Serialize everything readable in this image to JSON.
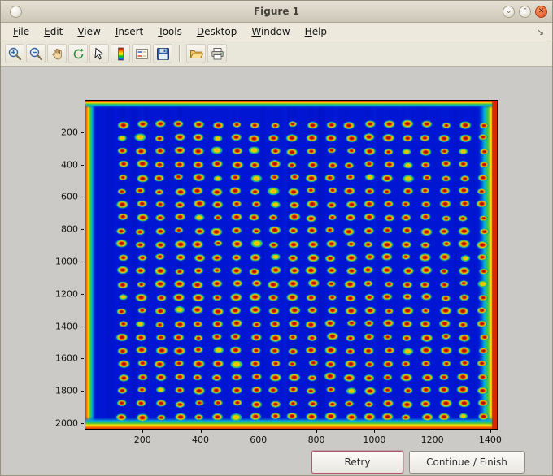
{
  "window": {
    "title": "Figure 1",
    "controls": {
      "shade": "⌄",
      "maximize": "⌃",
      "close": "✕"
    }
  },
  "menu": {
    "items": [
      {
        "label": "File"
      },
      {
        "label": "Edit"
      },
      {
        "label": "View"
      },
      {
        "label": "Insert"
      },
      {
        "label": "Tools"
      },
      {
        "label": "Desktop"
      },
      {
        "label": "Window"
      },
      {
        "label": "Help"
      }
    ],
    "dock_arrow": "↘"
  },
  "toolbar": {
    "tools": [
      "zoom-in",
      "zoom-out",
      "pan",
      "rotate-3d",
      "data-cursor",
      "colorbar",
      "insert-legend",
      "save-figure",
      "open-file",
      "print-figure"
    ]
  },
  "buttons": {
    "retry": "Retry",
    "continue": "Continue / Finish"
  },
  "chart_data": {
    "type": "heatmap",
    "title": "",
    "description": "Microarray plate scan shown with jet colormap: deep blue background, regular grid of red/orange spots with green halos, hot red/orange edges around the plate",
    "x_ticks": [
      200,
      400,
      600,
      800,
      1000,
      1200,
      1400
    ],
    "y_ticks": [
      200,
      400,
      600,
      800,
      1000,
      1200,
      1400,
      1600,
      1800,
      2000
    ],
    "x_range": [
      0,
      1420
    ],
    "y_range": [
      0,
      2030
    ],
    "grid": false,
    "legend": false,
    "spots": {
      "rows": 23,
      "cols": 20,
      "x_start": 128,
      "y_start": 148,
      "x_spacing": 65.5,
      "y_spacing": 82.2
    },
    "colors": {
      "background": "#0016d2",
      "spot_center": "#c41400",
      "spot_ring": "#ff8400",
      "spot_halo": "#46c832",
      "edge_hot": "#d82800",
      "edge_warm": "#ff7c00",
      "edge_mid": "#ffe000",
      "edge_cool": "#3fc63f",
      "edge_cyan": "#00b4dc"
    }
  }
}
